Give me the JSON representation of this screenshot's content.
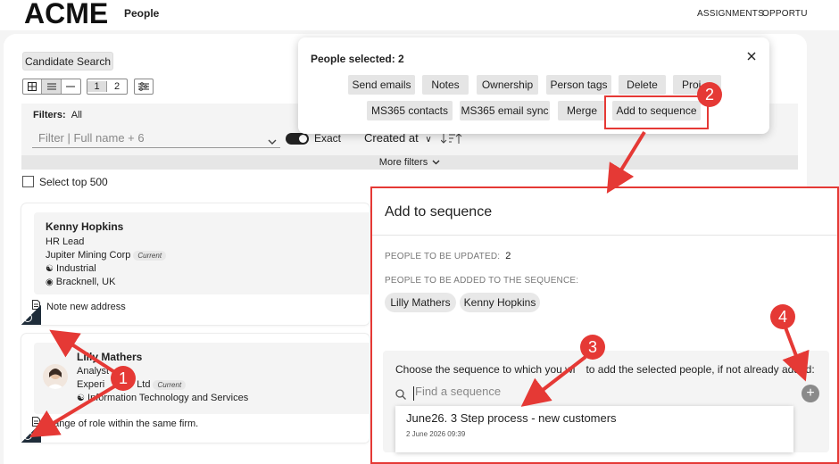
{
  "header": {
    "logo": "ACME",
    "app_title": "People",
    "nav": [
      "ASSIGNMENTS",
      "OPPORTU"
    ]
  },
  "toolbar": {
    "candidate_search": "Candidate Search",
    "page_1": "1",
    "page_2": "2"
  },
  "filters": {
    "label": "Filters:",
    "value": "All",
    "placeholder": "Filter | Full name + 6",
    "exact_label": "Exact",
    "sort_label": "Created at",
    "more_filters": "More filters"
  },
  "select_top": "Select top 500",
  "cards": [
    {
      "name": "Kenny Hopkins",
      "title": "HR Lead",
      "company": "Jupiter Mining Corp",
      "current": "Current",
      "industry": "Industrial",
      "location": "Bracknell, UK",
      "note": "Note new address"
    },
    {
      "name": "Lilly Mathers",
      "title": "Analyst",
      "company": "Experi",
      "company_tail": "Ltd",
      "current": "Current",
      "industry": "Information Technology and Services",
      "note": "hange of role within the same firm."
    }
  ],
  "selection": {
    "title": "People selected: 2",
    "row1": [
      "Send emails",
      "Notes",
      "Ownership",
      "Person tags",
      "Delete",
      "Proj"
    ],
    "row2": [
      "MS365 contacts",
      "MS365 email sync",
      "Merge",
      "Add to sequence"
    ]
  },
  "modal": {
    "title": "Add to sequence",
    "updated_label": "PEOPLE TO BE UPDATED:",
    "updated_count": "2",
    "added_label": "PEOPLE TO BE ADDED TO THE SEQUENCE:",
    "people": [
      "Lilly Mathers",
      "Kenny Hopkins"
    ],
    "choose_text": "Choose the sequence to which you wi",
    "choose_text_tail": "to add the selected people, if not already added:",
    "search_placeholder": "Find a sequence",
    "result_name": "June26. 3 Step process - new customers",
    "result_date": "2 June 2026 09:39"
  },
  "callouts": [
    "1",
    "2",
    "3",
    "4"
  ],
  "colors": {
    "callout": "#e53935",
    "corner": "#1f2d3a",
    "toggle": "#222222"
  }
}
